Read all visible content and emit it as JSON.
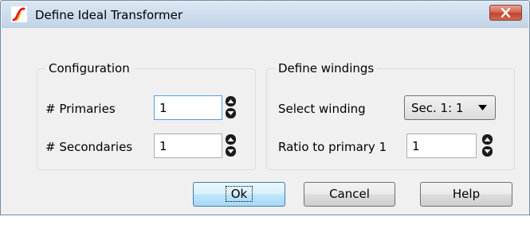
{
  "window": {
    "title": "Define Ideal Transformer",
    "app_icon": "simetrix-logo-icon"
  },
  "configuration": {
    "legend": "Configuration",
    "primaries_label": "# Primaries",
    "primaries_value": "1",
    "secondaries_label": "# Secondaries",
    "secondaries_value": "1"
  },
  "define_windings": {
    "legend": "Define windings",
    "select_label": "Select winding",
    "select_value": "Sec. 1: 1",
    "ratio_label": "Ratio to primary 1",
    "ratio_value": "1"
  },
  "buttons": {
    "ok": "Ok",
    "cancel": "Cancel",
    "help": "Help"
  },
  "colors": {
    "title_bar": "#c2d4e8",
    "close_button": "#c0442c",
    "focus_border": "#569de5",
    "default_button": "#3c7fb1"
  }
}
